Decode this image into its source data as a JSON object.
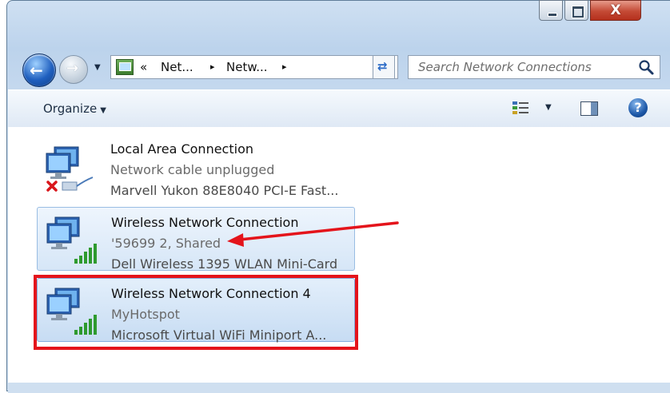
{
  "window": {
    "close_glyph": "X"
  },
  "nav": {
    "breadcrumb_prefix": "«",
    "crumbs": [
      "Net...",
      "Netw..."
    ],
    "separator": "▸",
    "search_placeholder": "Search Network Connections"
  },
  "toolbar": {
    "organize_label": "Organize"
  },
  "connections": [
    {
      "name": "Local Area Connection",
      "status": "Network cable unplugged",
      "device": "Marvell Yukon 88E8040 PCI-E Fast..."
    },
    {
      "name": "Wireless Network Connection",
      "status": "'59699  2, Shared",
      "device": "Dell Wireless 1395 WLAN Mini-Card"
    },
    {
      "name": "Wireless Network Connection 4",
      "status": "MyHotspot",
      "device": "Microsoft Virtual WiFi Miniport A..."
    }
  ],
  "colors": {
    "annotation_red": "#e4141b",
    "selection_blue": "#99bde3"
  }
}
